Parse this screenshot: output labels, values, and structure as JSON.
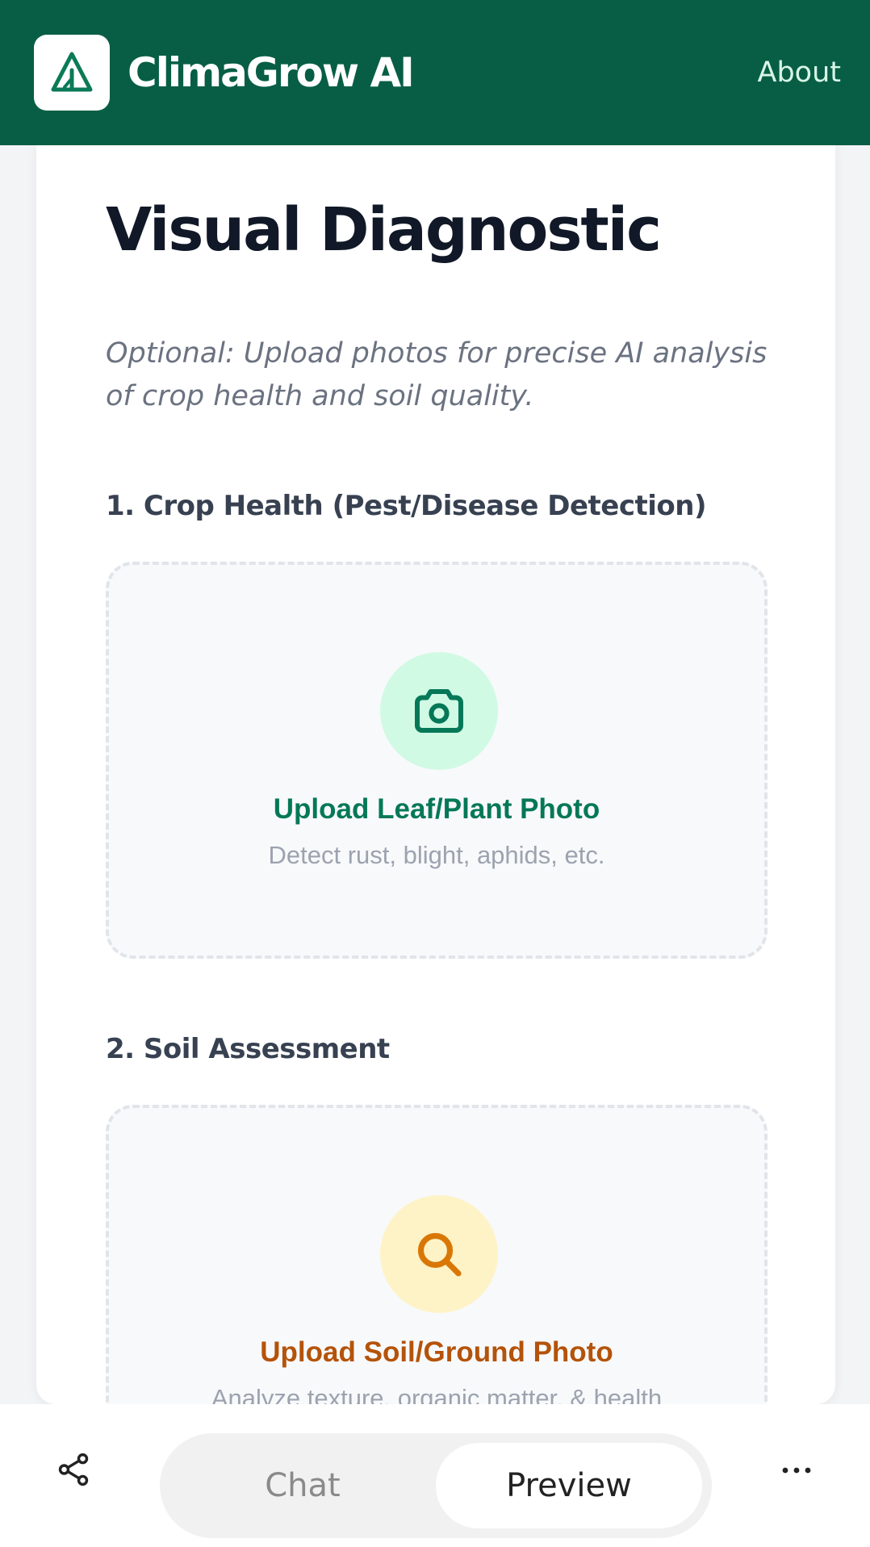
{
  "header": {
    "brand_name": "ClimaGrow AI",
    "about_label": "About",
    "logo_icon": "triangle-leaf-icon",
    "bg_color": "#075e45"
  },
  "main": {
    "title": "Visual Diagnostic",
    "subtitle": "Optional: Upload photos for precise AI analysis of crop health and soil quality.",
    "sections": [
      {
        "heading": "1. Crop Health (Pest/Disease Detection)",
        "upload_label": "Upload Leaf/Plant Photo",
        "hint": "Detect rust, blight, aphids, etc.",
        "icon": "camera-icon",
        "accent": "#047857"
      },
      {
        "heading": "2. Soil Assessment",
        "upload_label": "Upload Soil/Ground Photo",
        "hint": "Analyze texture, organic matter, & health",
        "icon": "search-icon",
        "accent": "#b45309"
      }
    ]
  },
  "bottom_bar": {
    "share_icon": "share-icon",
    "tabs": [
      "Chat",
      "Preview"
    ],
    "active_tab": "Preview",
    "more_icon": "more-icon"
  }
}
